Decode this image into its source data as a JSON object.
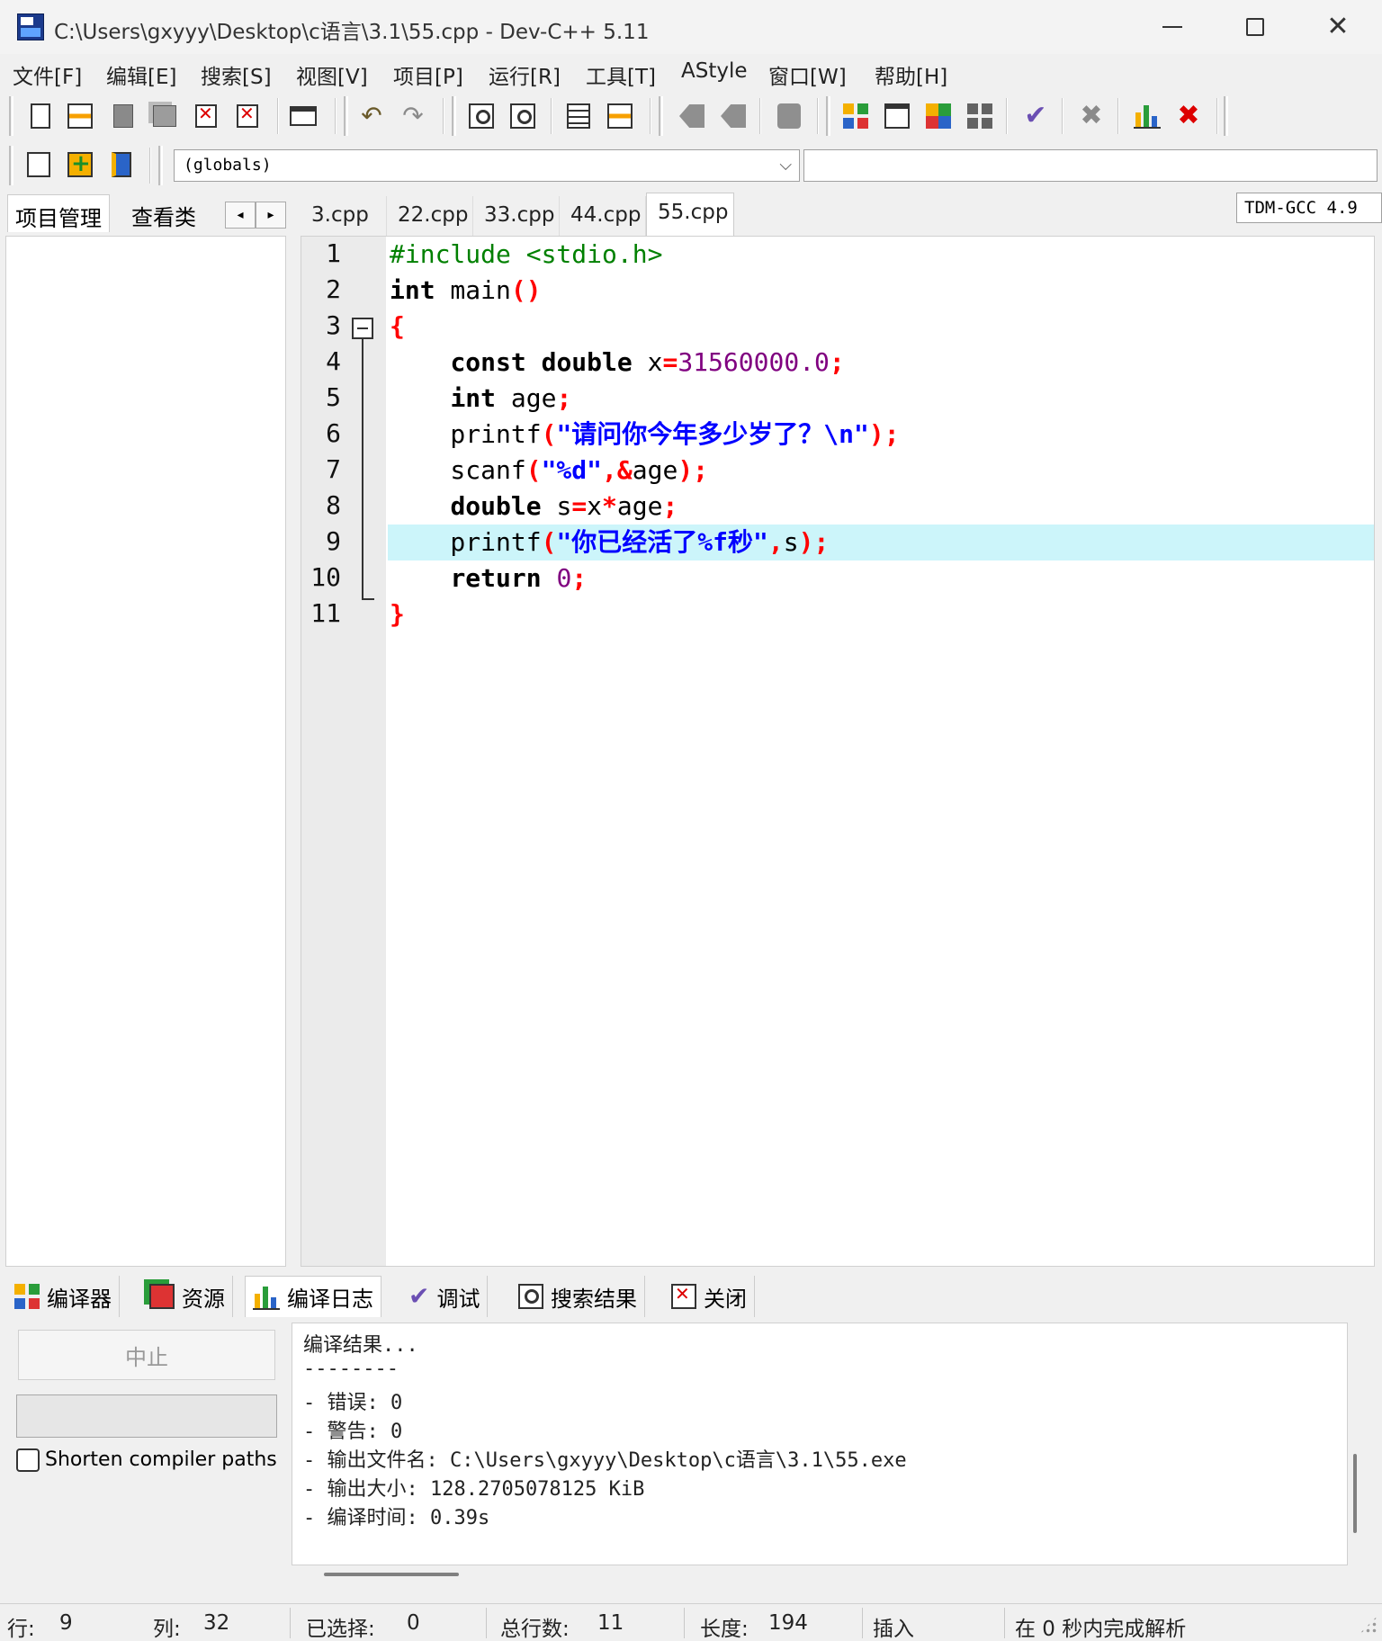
{
  "window": {
    "title": "C:\\Users\\gxyyy\\Desktop\\c语言\\3.1\\55.cpp - Dev-C++ 5.11"
  },
  "menu": {
    "items": [
      "文件[F]",
      "编辑[E]",
      "搜索[S]",
      "视图[V]",
      "项目[P]",
      "运行[R]",
      "工具[T]",
      "AStyle",
      "窗口[W]",
      "帮助[H]"
    ]
  },
  "toolbar": {
    "compiler": "TDM-GCC 4.9",
    "scope": "(globals)"
  },
  "left_panel": {
    "tabs": [
      "项目管理",
      "查看类"
    ],
    "nav_left": "◂",
    "nav_right": "▸"
  },
  "editor": {
    "tabs": [
      "3.cpp",
      "22.cpp",
      "33.cpp",
      "44.cpp",
      "55.cpp"
    ],
    "active_tab": "55.cpp",
    "line_numbers": [
      "1",
      "2",
      "3",
      "4",
      "5",
      "6",
      "7",
      "8",
      "9",
      "10",
      "11"
    ],
    "highlighted_line": 9,
    "code": [
      [
        {
          "t": "#include <stdio.h>",
          "c": "pp"
        }
      ],
      [
        {
          "t": "int",
          "c": "kw"
        },
        {
          "t": " main",
          "c": "plain"
        },
        {
          "t": "()",
          "c": "sym"
        }
      ],
      [
        {
          "t": "{",
          "c": "sym"
        }
      ],
      [
        {
          "t": "    ",
          "c": "plain"
        },
        {
          "t": "const",
          "c": "kw"
        },
        {
          "t": " ",
          "c": "plain"
        },
        {
          "t": "double",
          "c": "kw"
        },
        {
          "t": " x",
          "c": "plain"
        },
        {
          "t": "=",
          "c": "sym"
        },
        {
          "t": "31560000.0",
          "c": "num"
        },
        {
          "t": ";",
          "c": "sym"
        }
      ],
      [
        {
          "t": "    ",
          "c": "plain"
        },
        {
          "t": "int",
          "c": "kw"
        },
        {
          "t": " age",
          "c": "plain"
        },
        {
          "t": ";",
          "c": "sym"
        }
      ],
      [
        {
          "t": "    printf",
          "c": "plain"
        },
        {
          "t": "(",
          "c": "sym"
        },
        {
          "t": "\"请问你今年多少岁了？\\n\"",
          "c": "str"
        },
        {
          "t": ");",
          "c": "sym"
        }
      ],
      [
        {
          "t": "    scanf",
          "c": "plain"
        },
        {
          "t": "(",
          "c": "sym"
        },
        {
          "t": "\"%d\"",
          "c": "str"
        },
        {
          "t": ",&",
          "c": "sym"
        },
        {
          "t": "age",
          "c": "plain"
        },
        {
          "t": ");",
          "c": "sym"
        }
      ],
      [
        {
          "t": "    ",
          "c": "plain"
        },
        {
          "t": "double",
          "c": "kw"
        },
        {
          "t": " s",
          "c": "plain"
        },
        {
          "t": "=",
          "c": "sym"
        },
        {
          "t": "x",
          "c": "plain"
        },
        {
          "t": "*",
          "c": "sym"
        },
        {
          "t": "age",
          "c": "plain"
        },
        {
          "t": ";",
          "c": "sym"
        }
      ],
      [
        {
          "t": "    printf",
          "c": "plain"
        },
        {
          "t": "(",
          "c": "sym"
        },
        {
          "t": "\"你已经活了%f秒\"",
          "c": "str"
        },
        {
          "t": ",",
          "c": "sym"
        },
        {
          "t": "s",
          "c": "plain"
        },
        {
          "t": ");",
          "c": "sym"
        }
      ],
      [
        {
          "t": "    ",
          "c": "plain"
        },
        {
          "t": "return",
          "c": "kw"
        },
        {
          "t": " ",
          "c": "plain"
        },
        {
          "t": "0",
          "c": "num"
        },
        {
          "t": ";",
          "c": "sym"
        }
      ],
      [
        {
          "t": "}",
          "c": "sym"
        }
      ]
    ]
  },
  "bottom_tabs": [
    {
      "label": "编译器",
      "icon": "compiler-icon"
    },
    {
      "label": "资源",
      "icon": "resources-icon"
    },
    {
      "label": "编译日志",
      "icon": "compile-log-icon"
    },
    {
      "label": "调试",
      "icon": "debug-check-icon"
    },
    {
      "label": "搜索结果",
      "icon": "search-results-icon"
    },
    {
      "label": "关闭",
      "icon": "close-icon"
    }
  ],
  "bottom_panel": {
    "abort_label": "中止",
    "shorten_label": "Shorten compiler paths",
    "log_lines": [
      "编译结果...",
      "--------",
      "- 错误: 0",
      "- 警告: 0",
      "- 输出文件名: C:\\Users\\gxyyy\\Desktop\\c语言\\3.1\\55.exe",
      "- 输出大小: 128.2705078125 KiB",
      "- 编译时间: 0.39s"
    ]
  },
  "status": {
    "row_label": "行:",
    "row_value": "9",
    "col_label": "列:",
    "col_value": "32",
    "sel_label": "已选择:",
    "sel_value": "0",
    "lines_label": "总行数:",
    "lines_value": "11",
    "len_label": "长度:",
    "len_value": "194",
    "mode": "插入",
    "parse": "在 0 秒内完成解析"
  }
}
